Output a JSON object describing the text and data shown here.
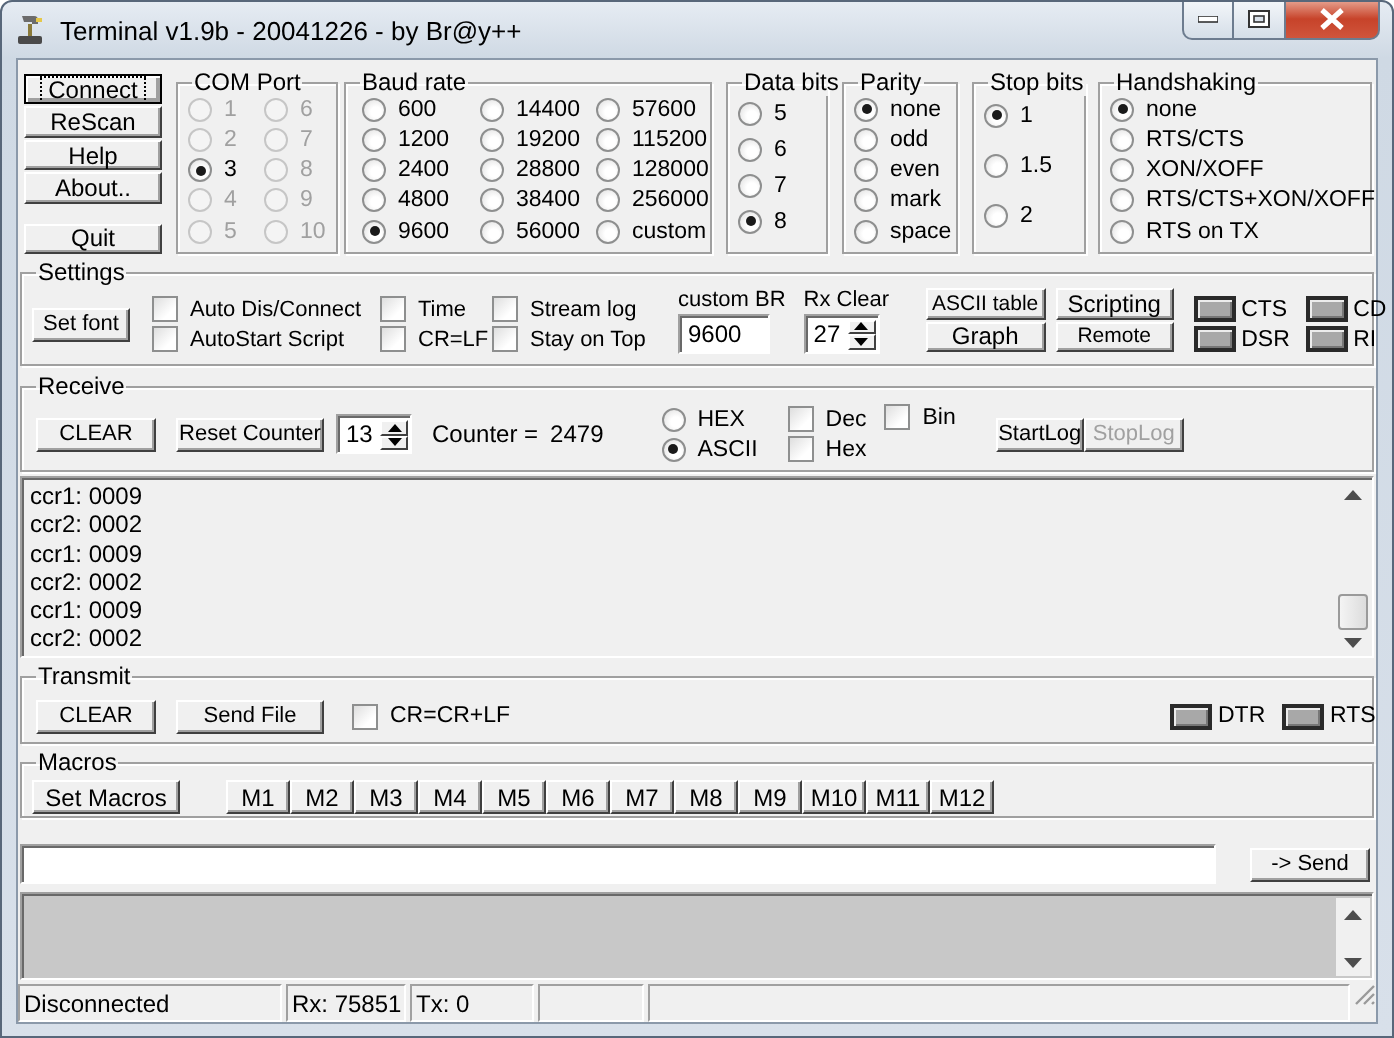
{
  "window": {
    "title": "Terminal v1.9b - 20041226 - by Br@y++"
  },
  "connection_buttons": [
    {
      "label": "Connect",
      "focused": true
    },
    {
      "label": "ReScan",
      "focused": false
    },
    {
      "label": "Help",
      "focused": false
    },
    {
      "label": "About..",
      "focused": false
    },
    {
      "label": "Quit",
      "focused": false
    }
  ],
  "com_port": {
    "title": "COM Port",
    "options": [
      {
        "label": "1",
        "selected": false,
        "disabled": true
      },
      {
        "label": "2",
        "selected": false,
        "disabled": true
      },
      {
        "label": "3",
        "selected": true,
        "disabled": false
      },
      {
        "label": "4",
        "selected": false,
        "disabled": true
      },
      {
        "label": "5",
        "selected": false,
        "disabled": true
      },
      {
        "label": "6",
        "selected": false,
        "disabled": true
      },
      {
        "label": "7",
        "selected": false,
        "disabled": true
      },
      {
        "label": "8",
        "selected": false,
        "disabled": true
      },
      {
        "label": "9",
        "selected": false,
        "disabled": true
      },
      {
        "label": "10",
        "selected": false,
        "disabled": true
      }
    ]
  },
  "baud_rate": {
    "title": "Baud rate",
    "options": [
      {
        "label": "600",
        "selected": false
      },
      {
        "label": "1200",
        "selected": false
      },
      {
        "label": "2400",
        "selected": false
      },
      {
        "label": "4800",
        "selected": false
      },
      {
        "label": "9600",
        "selected": true
      },
      {
        "label": "14400",
        "selected": false
      },
      {
        "label": "19200",
        "selected": false
      },
      {
        "label": "28800",
        "selected": false
      },
      {
        "label": "38400",
        "selected": false
      },
      {
        "label": "56000",
        "selected": false
      },
      {
        "label": "57600",
        "selected": false
      },
      {
        "label": "115200",
        "selected": false
      },
      {
        "label": "128000",
        "selected": false
      },
      {
        "label": "256000",
        "selected": false
      },
      {
        "label": "custom",
        "selected": false
      }
    ]
  },
  "data_bits": {
    "title": "Data bits",
    "options": [
      {
        "label": "5",
        "selected": false
      },
      {
        "label": "6",
        "selected": false
      },
      {
        "label": "7",
        "selected": false
      },
      {
        "label": "8",
        "selected": true
      }
    ]
  },
  "parity": {
    "title": "Parity",
    "options": [
      {
        "label": "none",
        "selected": true
      },
      {
        "label": "odd",
        "selected": false
      },
      {
        "label": "even",
        "selected": false
      },
      {
        "label": "mark",
        "selected": false
      },
      {
        "label": "space",
        "selected": false
      }
    ]
  },
  "stop_bits": {
    "title": "Stop bits",
    "options": [
      {
        "label": "1",
        "selected": true
      },
      {
        "label": "1.5",
        "selected": false
      },
      {
        "label": "2",
        "selected": false
      }
    ]
  },
  "handshaking": {
    "title": "Handshaking",
    "options": [
      {
        "label": "none",
        "selected": true
      },
      {
        "label": "RTS/CTS",
        "selected": false
      },
      {
        "label": "XON/XOFF",
        "selected": false
      },
      {
        "label": "RTS/CTS+XON/XOFF",
        "selected": false
      },
      {
        "label": "RTS on TX",
        "selected": false
      }
    ]
  },
  "settings": {
    "title": "Settings",
    "set_font_button": "Set font",
    "checkboxes": [
      {
        "label": "Auto Dis/Connect",
        "checked": false
      },
      {
        "label": "AutoStart Script",
        "checked": false
      },
      {
        "label": "Time",
        "checked": false
      },
      {
        "label": "CR=LF",
        "checked": false
      },
      {
        "label": "Stream log",
        "checked": false
      },
      {
        "label": "Stay on Top",
        "checked": false
      }
    ],
    "custom_br": {
      "label": "custom BR",
      "value": "9600"
    },
    "rx_clear": {
      "label": "Rx Clear",
      "value": "27"
    },
    "buttons": [
      {
        "label": "ASCII table",
        "kind": "small"
      },
      {
        "label": "Graph",
        "kind": "normal"
      },
      {
        "label": "Scripting",
        "kind": "normal"
      },
      {
        "label": "Remote",
        "kind": "small"
      }
    ],
    "signals": [
      {
        "label": "CTS",
        "on": false
      },
      {
        "label": "DSR",
        "on": false
      },
      {
        "label": "CD",
        "on": false
      },
      {
        "label": "RI",
        "on": false
      }
    ]
  },
  "receive": {
    "title": "Receive",
    "clear_button": "CLEAR",
    "reset_button": "Reset Counter",
    "counter_step": "13",
    "counter_label": "Counter =",
    "counter_value": "2479",
    "display_modes": [
      {
        "label": "HEX",
        "selected": false
      },
      {
        "label": "ASCII",
        "selected": true
      }
    ],
    "checkboxes": [
      {
        "label": "Dec",
        "checked": false
      },
      {
        "label": "Hex",
        "checked": false
      },
      {
        "label": "Bin",
        "checked": false
      }
    ],
    "log_buttons": [
      {
        "label": "StartLog",
        "disabled": false
      },
      {
        "label": "StopLog",
        "disabled": true
      }
    ],
    "lines": [
      "ccr1: 0009",
      "ccr2: 0002",
      "ccr1: 0009",
      "ccr2: 0002",
      "ccr1: 0009",
      "ccr2: 0002"
    ]
  },
  "transmit": {
    "title": "Transmit",
    "clear_button": "CLEAR",
    "send_file_button": "Send File",
    "checkbox": {
      "label": "CR=CR+LF",
      "checked": false
    },
    "signals": [
      {
        "label": "DTR",
        "on": false
      },
      {
        "label": "RTS",
        "on": false
      }
    ]
  },
  "macros": {
    "title": "Macros",
    "set_button": "Set Macros",
    "keys": [
      "M1",
      "M2",
      "M3",
      "M4",
      "M5",
      "M6",
      "M7",
      "M8",
      "M9",
      "M10",
      "M11",
      "M12"
    ]
  },
  "send_button": "-> Send",
  "status_bar": [
    "Disconnected",
    "Rx: 75851",
    "Tx: 0"
  ]
}
